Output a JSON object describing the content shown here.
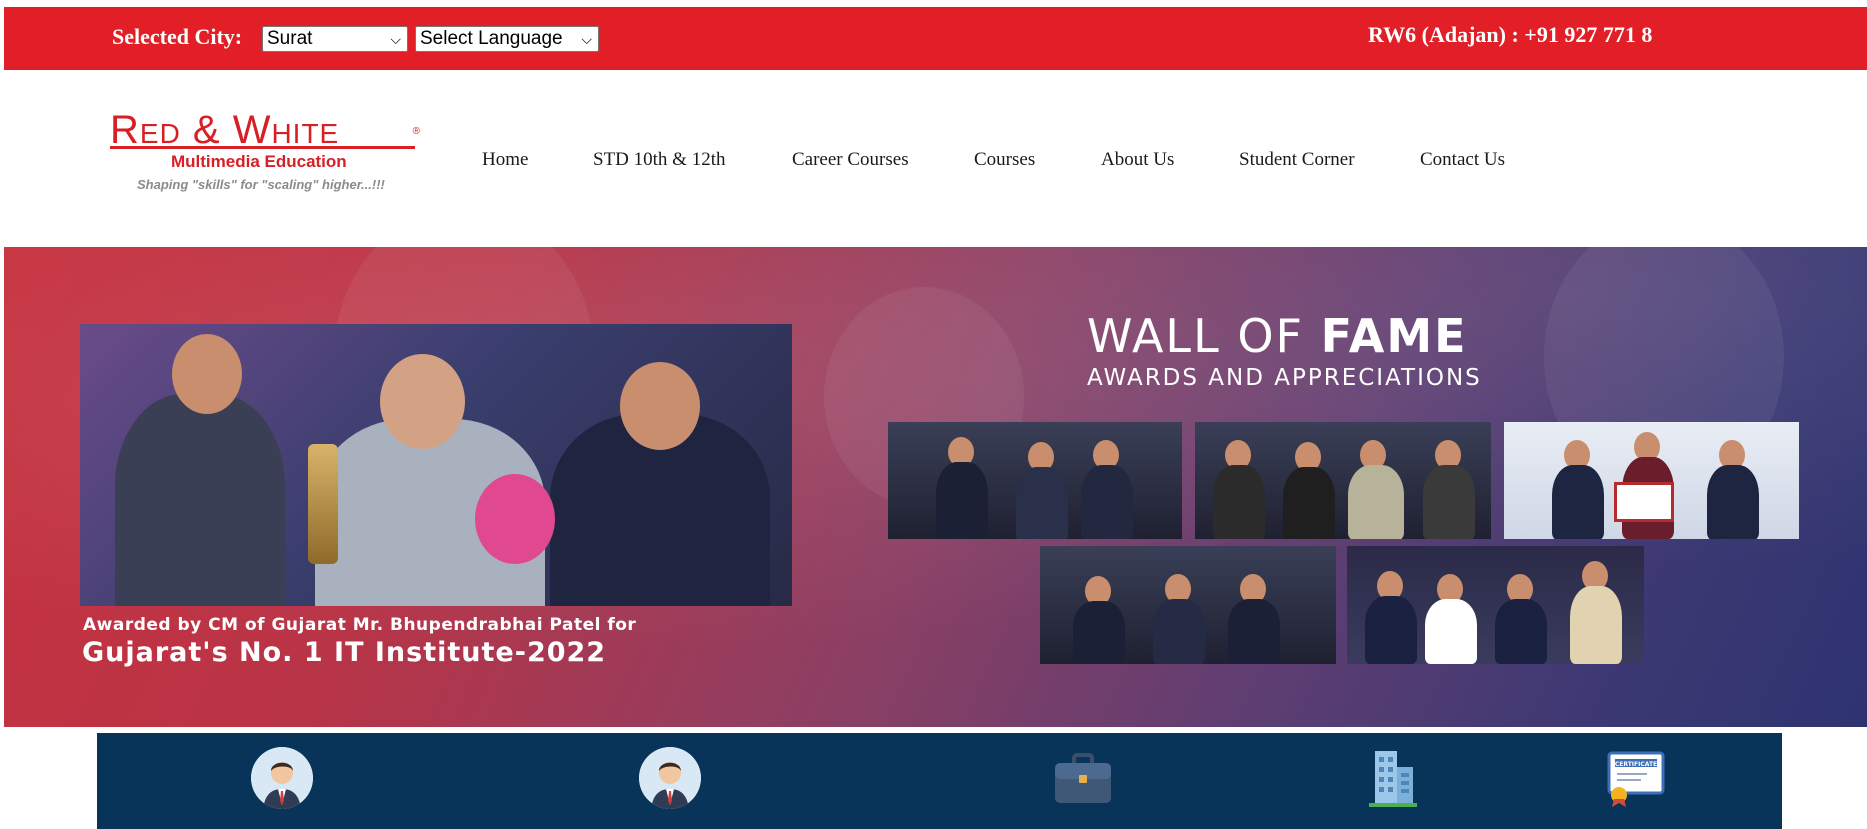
{
  "topbar": {
    "city_label": "Selected City:",
    "city_value": "Surat",
    "language_value": "Select Language",
    "phone": "RW6 (Adajan) : +91 927 771 8"
  },
  "logo": {
    "title": "Red & White",
    "registered": "®",
    "subtitle": "Multimedia Education",
    "tagline": "Shaping \"skills\" for \"scaling\" higher...!!!"
  },
  "nav": [
    {
      "label": "Home"
    },
    {
      "label": "STD 10th & 12th"
    },
    {
      "label": "Career Courses"
    },
    {
      "label": "Courses"
    },
    {
      "label": "About Us"
    },
    {
      "label": "Student Corner"
    },
    {
      "label": "Contact Us"
    }
  ],
  "banner": {
    "caption_small": "Awarded by CM of Gujarat Mr. Bhupendrabhai Patel for",
    "caption_large": "Gujarat's No. 1 IT Institute-2022",
    "wall_title_light": "WALL OF ",
    "wall_title_bold": "FAME",
    "wall_subtitle": "AWARDS AND APPRECIATIONS"
  },
  "features": {
    "icons": [
      "man-avatar-icon",
      "man-avatar-icon",
      "briefcase-icon",
      "building-icon",
      "certificate-icon"
    ]
  },
  "colors": {
    "brand_red": "#e21e26",
    "features_bg": "#073458"
  }
}
